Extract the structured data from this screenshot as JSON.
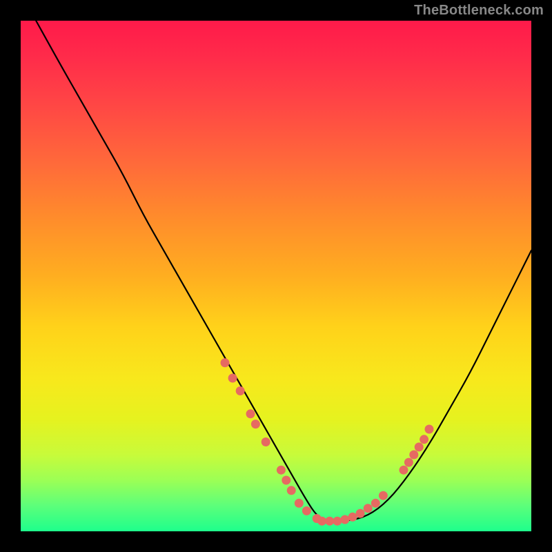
{
  "watermark": "TheBottleneck.com",
  "colors": {
    "frame_border": "#000000",
    "curve_stroke": "#000000",
    "marker_fill": "#e66a62",
    "gradient_top": "#ff1a4a",
    "gradient_bottom": "#1eff8c"
  },
  "chart_data": {
    "type": "line",
    "title": "",
    "xlabel": "",
    "ylabel": "",
    "xlim": [
      0,
      100
    ],
    "ylim": [
      0,
      100
    ],
    "gradient_axis": "y (low=green bottom, high=red top)",
    "series": [
      {
        "name": "bottleneck-curve",
        "x": [
          3,
          8,
          12,
          16,
          20,
          24,
          28,
          32,
          36,
          40,
          44,
          48,
          52,
          56,
          58,
          60,
          64,
          68,
          72,
          76,
          80,
          84,
          88,
          92,
          96,
          100
        ],
        "y": [
          100,
          91,
          84,
          77,
          70,
          62,
          55,
          48,
          41,
          34,
          27,
          20,
          13,
          6,
          3,
          2,
          2,
          3,
          6,
          11,
          17,
          24,
          31,
          39,
          47,
          55
        ]
      }
    ],
    "markers": {
      "name": "red-dots",
      "points": [
        {
          "x": 40,
          "y": 33
        },
        {
          "x": 41.5,
          "y": 30
        },
        {
          "x": 43,
          "y": 27.5
        },
        {
          "x": 45,
          "y": 23
        },
        {
          "x": 46,
          "y": 21
        },
        {
          "x": 48,
          "y": 17.5
        },
        {
          "x": 51,
          "y": 12
        },
        {
          "x": 52,
          "y": 10
        },
        {
          "x": 53,
          "y": 8
        },
        {
          "x": 54.5,
          "y": 5.5
        },
        {
          "x": 56,
          "y": 4
        },
        {
          "x": 58,
          "y": 2.5
        },
        {
          "x": 59,
          "y": 2
        },
        {
          "x": 60.5,
          "y": 2
        },
        {
          "x": 62,
          "y": 2
        },
        {
          "x": 63.5,
          "y": 2.3
        },
        {
          "x": 65,
          "y": 2.8
        },
        {
          "x": 66.5,
          "y": 3.5
        },
        {
          "x": 68,
          "y": 4.5
        },
        {
          "x": 69.5,
          "y": 5.5
        },
        {
          "x": 71,
          "y": 7
        },
        {
          "x": 75,
          "y": 12
        },
        {
          "x": 76,
          "y": 13.5
        },
        {
          "x": 77,
          "y": 15
        },
        {
          "x": 78,
          "y": 16.5
        },
        {
          "x": 79,
          "y": 18
        },
        {
          "x": 80,
          "y": 20
        }
      ]
    }
  }
}
